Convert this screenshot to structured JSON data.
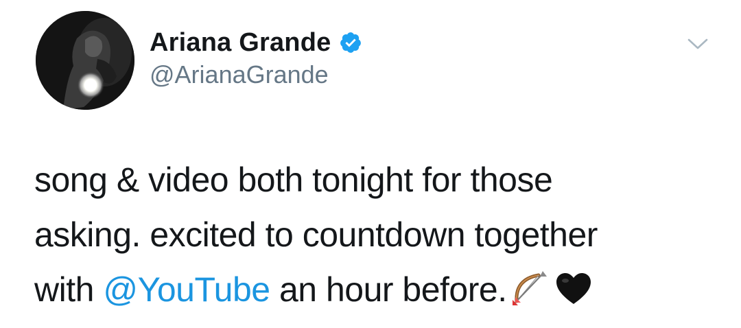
{
  "author": {
    "display_name": "Ariana Grande",
    "handle": "@ArianaGrande",
    "verified": true
  },
  "icons": {
    "verified": "verified-badge-icon",
    "caret": "chevron-down-icon",
    "avatar": "profile-photo",
    "emoji_1": "bow-and-arrow-emoji",
    "emoji_2": "black-heart-emoji"
  },
  "colors": {
    "text": "#14171a",
    "handle": "#657786",
    "link": "#1b95e0",
    "verified": "#1da1f2"
  },
  "tweet": {
    "line1": "song & video both tonight for those",
    "line2": "asking. excited to countdown together",
    "line3_before": "with ",
    "mention": "@YouTube",
    "line3_after": " an hour before."
  }
}
